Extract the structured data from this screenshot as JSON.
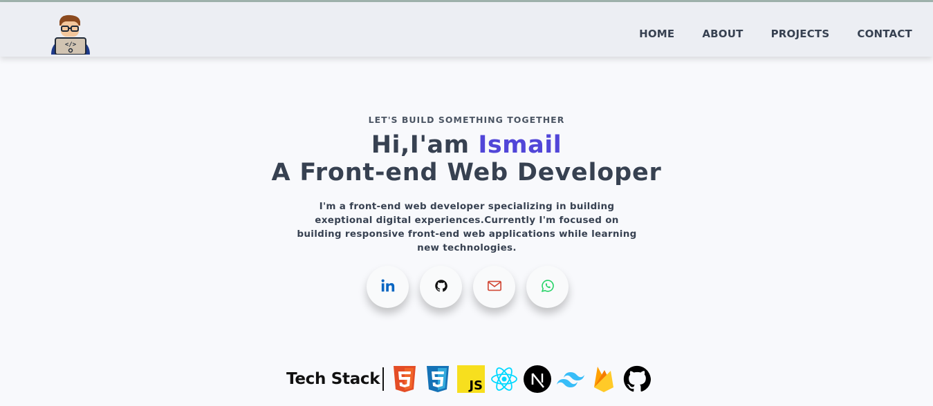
{
  "nav": {
    "items": [
      "HOME",
      "ABOUT",
      "PROJECTS",
      "CONTACT"
    ]
  },
  "hero": {
    "tagline": "LET'S BUILD SOMETHING TOGETHER",
    "greeting": "Hi,I'am ",
    "name": "Ismail",
    "role": "A Front-end Web Developer",
    "description": "I'm a front-end web developer specializing in building exeptional digital experiences.Currently I'm focused on building responsive front-end web applications while learning new technologies."
  },
  "socials": [
    {
      "icon": "linkedin-icon",
      "color": "#0a66c2"
    },
    {
      "icon": "github-icon",
      "color": "#111111"
    },
    {
      "icon": "mail-icon",
      "color": "#d14836"
    },
    {
      "icon": "whatsapp-icon",
      "color": "#25d366"
    }
  ],
  "tech_stack": {
    "title": "Tech Stack",
    "icons": [
      "html5-icon",
      "css3-icon",
      "javascript-icon",
      "react-icon",
      "nextjs-icon",
      "tailwind-icon",
      "firebase-icon",
      "github-icon"
    ]
  },
  "colors": {
    "accent": "#5146d8",
    "text": "#374151",
    "header_bg": "#eceef3",
    "page_bg": "#f8f9fc"
  }
}
